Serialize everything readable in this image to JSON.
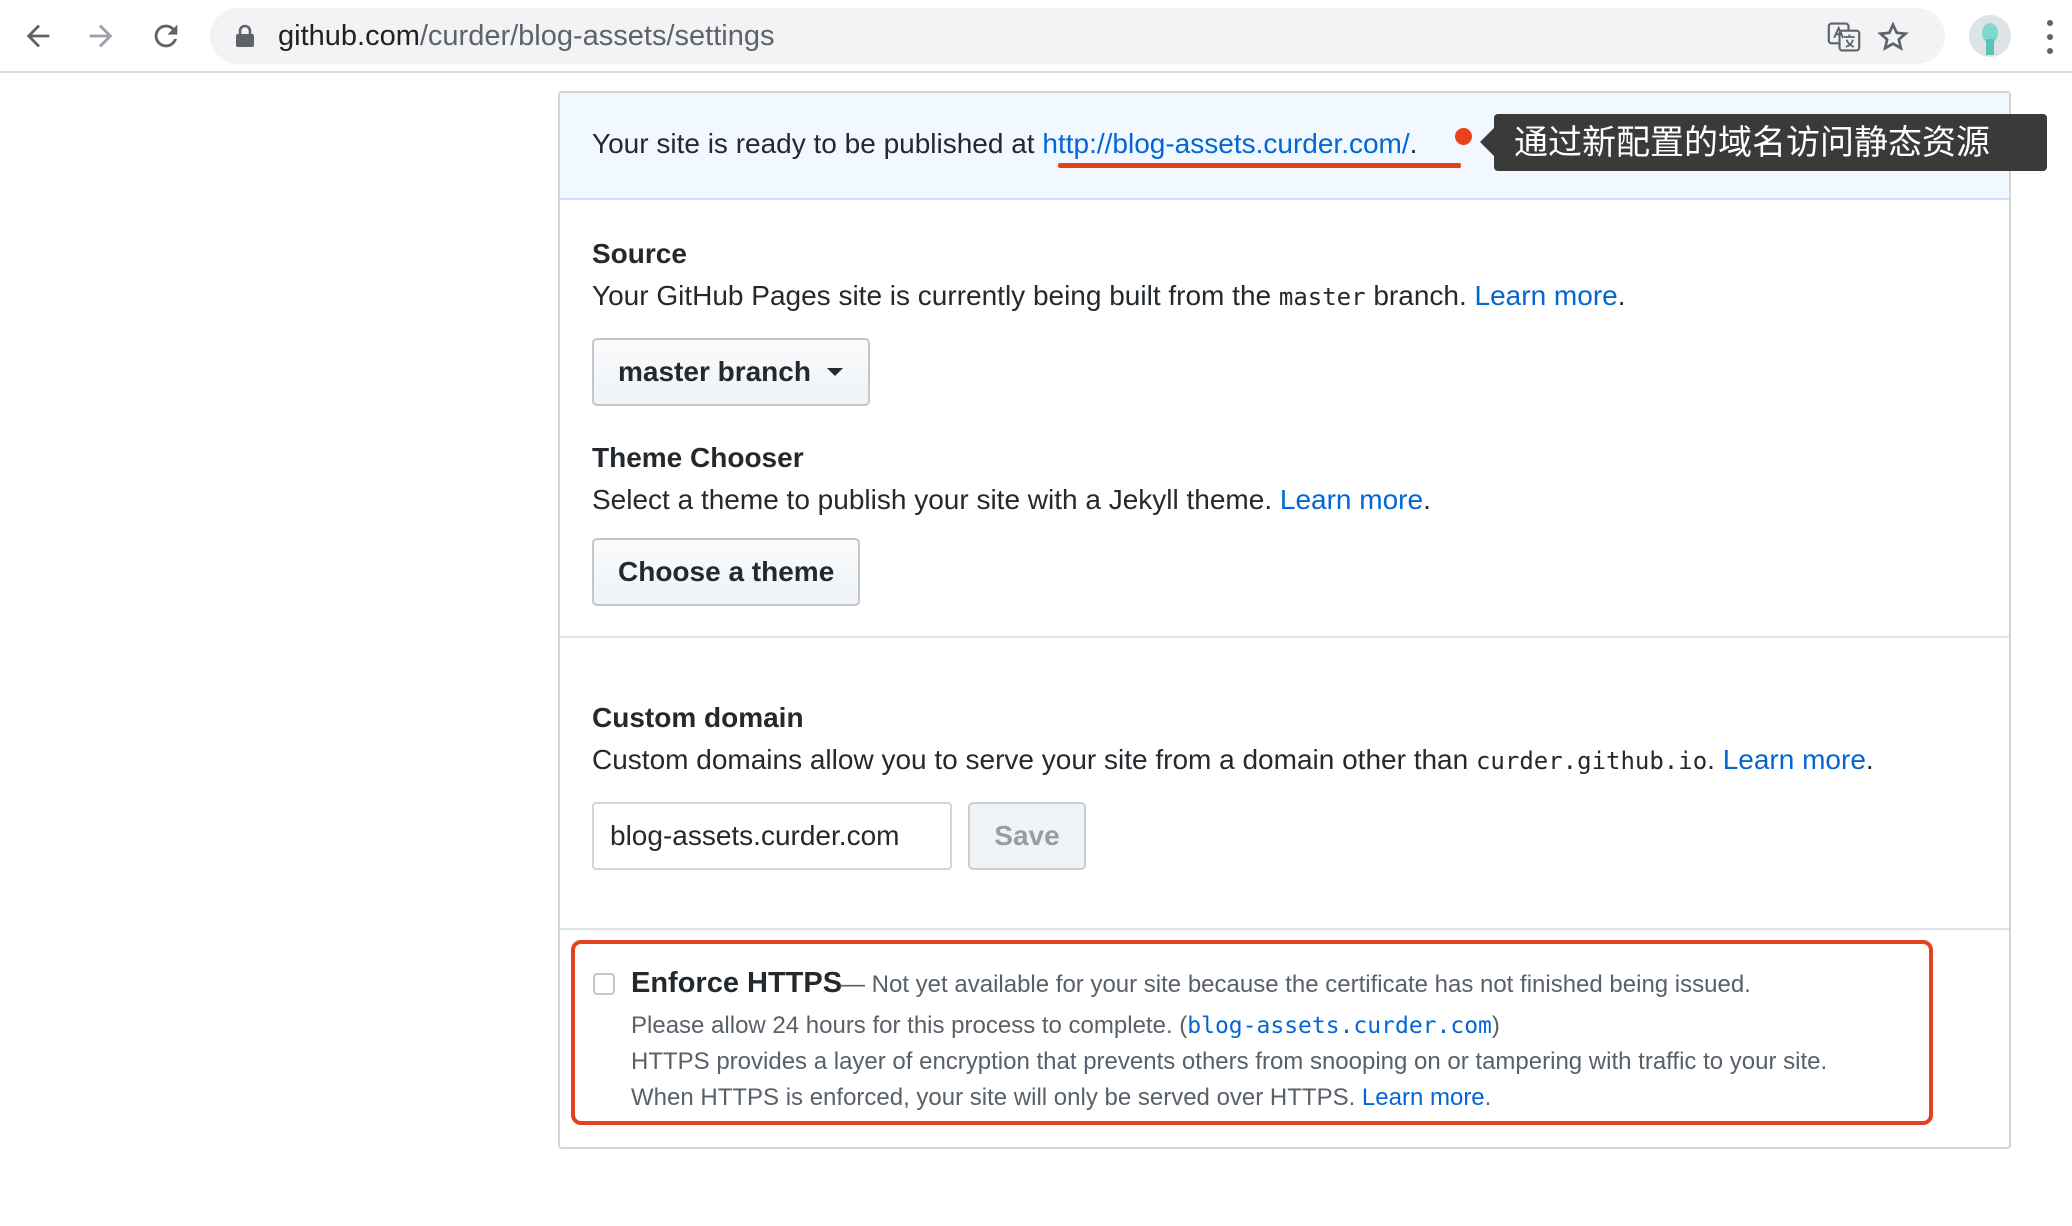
{
  "browser": {
    "url_host": "github.com",
    "url_path": "/curder/blog-assets/settings"
  },
  "flash": {
    "text": "Your site is ready to be published at ",
    "link": "http://blog-assets.curder.com/",
    "suffix": "."
  },
  "annotation": {
    "callout": "通过新配置的域名访问静态资源",
    "accent_color": "#e3421e"
  },
  "source": {
    "title": "Source",
    "desc_before": "Your GitHub Pages site is currently being built from the ",
    "desc_code": "master",
    "desc_after": " branch. ",
    "learn_more": "Learn more",
    "period": ".",
    "branch_button": "master branch"
  },
  "theme": {
    "title": "Theme Chooser",
    "desc": "Select a theme to publish your site with a Jekyll theme. ",
    "learn_more": "Learn more",
    "period": ".",
    "button": "Choose a theme"
  },
  "custom_domain": {
    "title": "Custom domain",
    "desc": "Custom domains allow you to serve your site from a domain other than ",
    "desc_code": "curder.github.io",
    "desc_after": ". ",
    "learn_more": "Learn more",
    "period": ".",
    "input_value": "blog-assets.curder.com",
    "save_button": "Save"
  },
  "https": {
    "title": "Enforce HTTPS",
    "desc": "— Not yet available for your site because the certificate has not finished being issued.",
    "line1_before": "Please allow 24 hours for this process to complete. (",
    "line1_code": "blog-assets.curder.com",
    "line1_after": ")",
    "line2": "HTTPS provides a layer of encryption that prevents others from snooping on or tampering with traffic to your site.",
    "line3": "When HTTPS is enforced, your site will only be served over HTTPS. ",
    "learn_more": "Learn more",
    "period": "."
  }
}
